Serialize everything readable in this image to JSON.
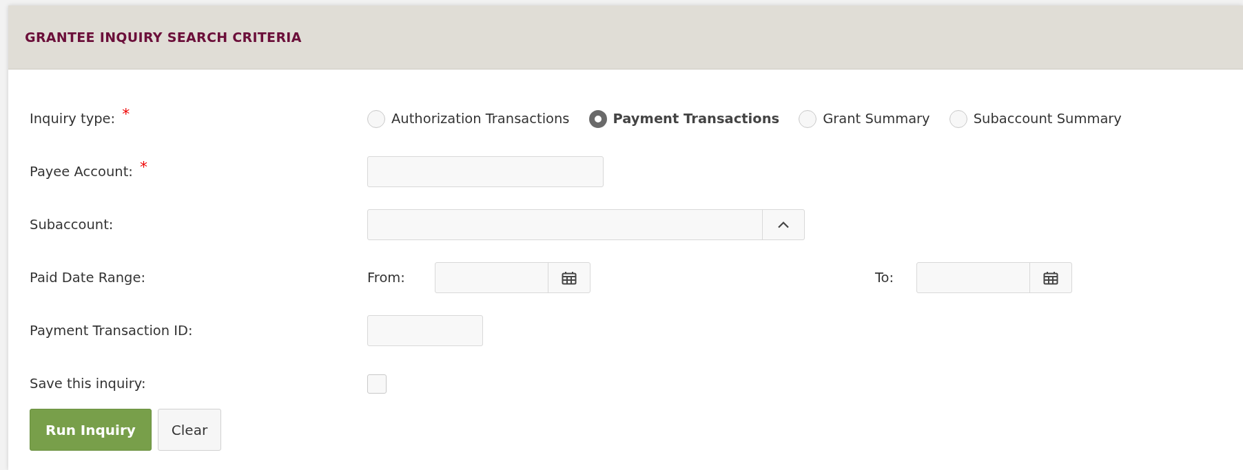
{
  "panel": {
    "title": "GRANTEE INQUIRY SEARCH CRITERIA"
  },
  "rows": [
    {
      "kind": "radios",
      "label": "Inquiry type:",
      "required_mark": "*",
      "options": [
        {
          "label": "Authorization Transactions",
          "selected": false
        },
        {
          "label": "Payment Transactions",
          "selected": true
        },
        {
          "label": "Grant Summary",
          "selected": false
        },
        {
          "label": "Subaccount Summary",
          "selected": false
        }
      ]
    },
    {
      "kind": "wide_text",
      "label": "Payee Account:",
      "required_mark": "*"
    },
    {
      "kind": "combo",
      "label": "Subaccount:"
    },
    {
      "kind": "daterange",
      "label": "Paid Date Range:",
      "from_label": "From:",
      "to_label": "To:"
    },
    {
      "kind": "short_text",
      "label": "Payment Transaction ID:"
    },
    {
      "kind": "checkbox",
      "label": "Save this inquiry:",
      "checked": false
    }
  ],
  "buttons": [
    {
      "label": "Run Inquiry",
      "kind": "primary"
    },
    {
      "label": "Clear",
      "kind": "secondary"
    }
  ]
}
